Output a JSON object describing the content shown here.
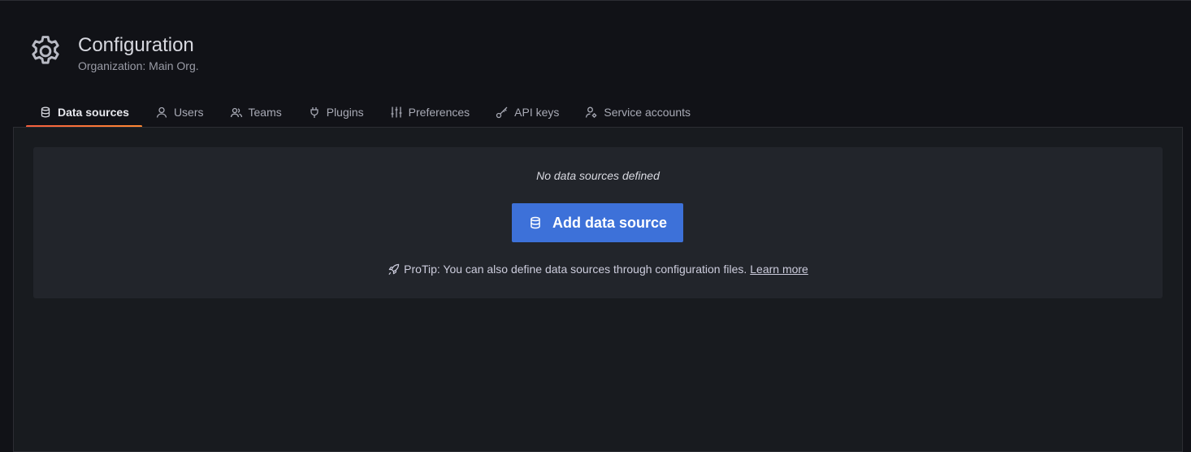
{
  "header": {
    "icon": "gear-icon",
    "title": "Configuration",
    "subtitle": "Organization: Main Org."
  },
  "tabs": [
    {
      "label": "Data sources",
      "icon": "database-icon",
      "active": true
    },
    {
      "label": "Users",
      "icon": "user-icon",
      "active": false
    },
    {
      "label": "Teams",
      "icon": "users-icon",
      "active": false
    },
    {
      "label": "Plugins",
      "icon": "plug-icon",
      "active": false
    },
    {
      "label": "Preferences",
      "icon": "sliders-icon",
      "active": false
    },
    {
      "label": "API keys",
      "icon": "key-icon",
      "active": false
    },
    {
      "label": "Service accounts",
      "icon": "user-cog-icon",
      "active": false
    }
  ],
  "empty_state": {
    "title": "No data sources defined",
    "button_label": "Add data source",
    "button_icon": "database-icon",
    "protip_icon": "rocket-icon",
    "protip_text": "ProTip: You can also define data sources through configuration files.",
    "protip_link": "Learn more"
  },
  "colors": {
    "background": "#111217",
    "panel": "#22252b",
    "primary_button": "#3d71d9",
    "active_tab_underline": "#f55f3e"
  }
}
